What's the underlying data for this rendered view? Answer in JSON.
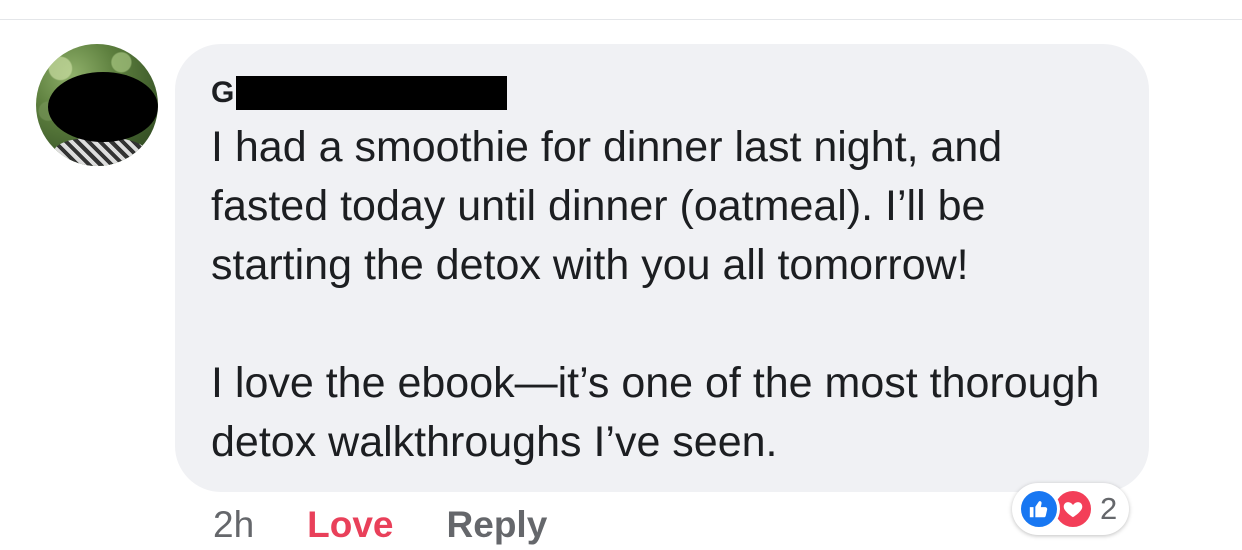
{
  "comment": {
    "author_initial": "G",
    "paragraphs": [
      "I had a smoothie for dinner last night, and fasted today until dinner (oatmeal). I’ll be starting the detox with you all tomorrow!",
      "I love the ebook—it’s one of the most thorough detox walkthroughs I’ve seen."
    ]
  },
  "actions": {
    "timestamp": "2h",
    "love_label": "Love",
    "reply_label": "Reply"
  },
  "reactions": {
    "icons": [
      "like-icon",
      "heart-icon"
    ],
    "count": "2"
  },
  "colors": {
    "bubble_bg": "#f0f1f4",
    "love": "#e9405a",
    "like_blue": "#1877f2",
    "heart_red": "#f33e58",
    "muted": "#65676b"
  }
}
